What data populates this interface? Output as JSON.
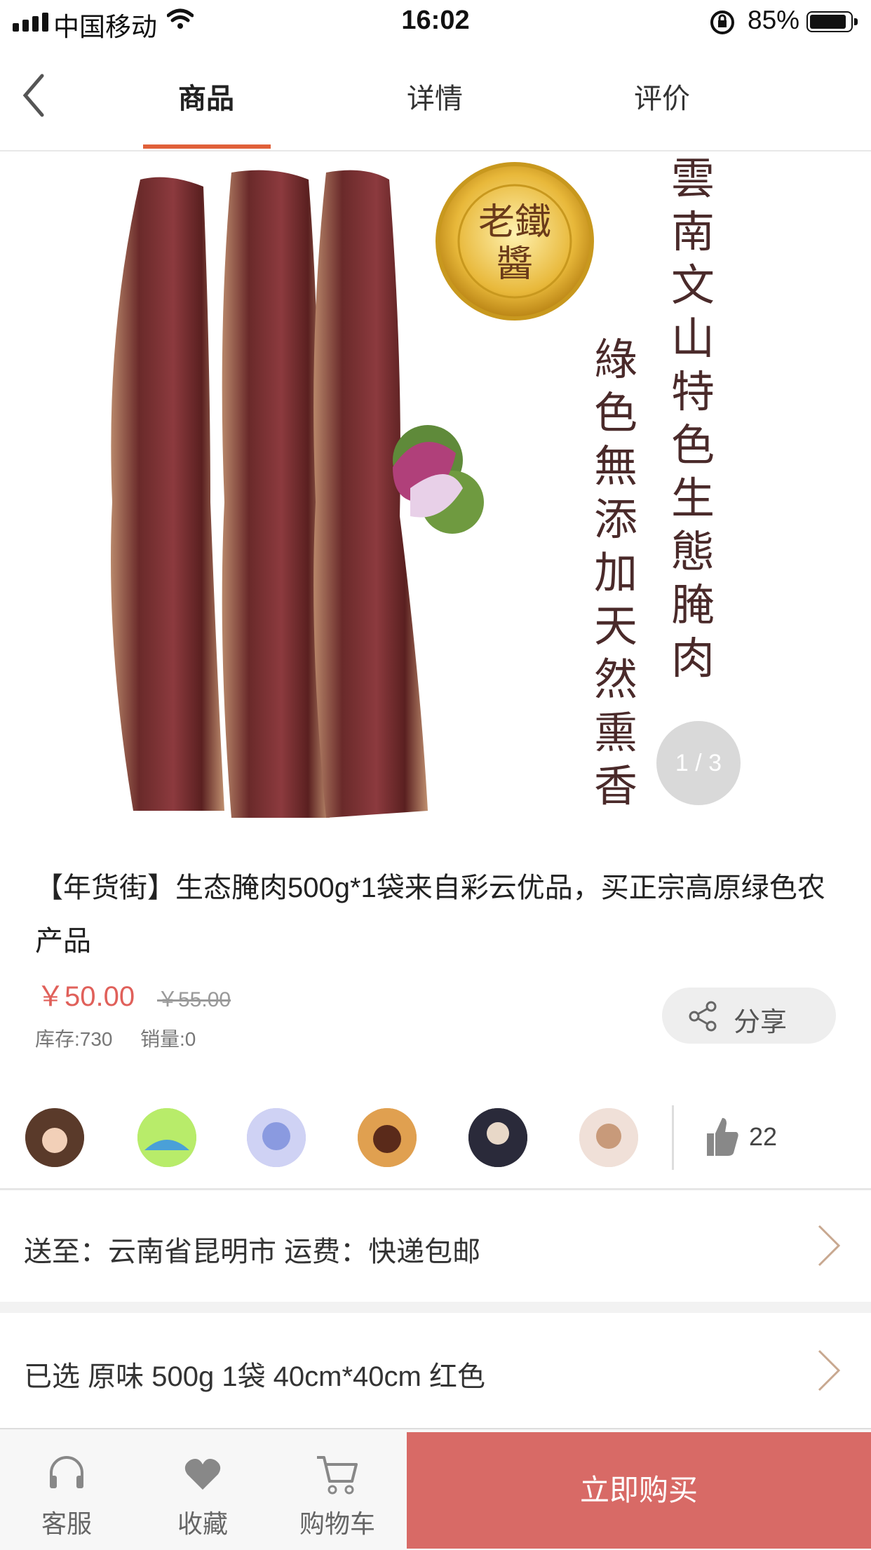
{
  "status_bar": {
    "carrier": "中国移动",
    "time": "16:02",
    "battery": "85%"
  },
  "nav": {
    "tabs": [
      {
        "label": "商品"
      },
      {
        "label": "详情"
      },
      {
        "label": "评价"
      }
    ],
    "active_tab": "商品"
  },
  "hero": {
    "brand_seal": "老鐵醬",
    "headline_vertical": "雲南文山特色生態腌肉",
    "sub_vertical": "綠色無添加天然熏香",
    "pager": "1 / 3"
  },
  "product": {
    "title": "【年货街】生态腌肉500g*1袋来自彩云优品，买正宗高原绿色农产品",
    "price": "￥50.00",
    "old_price": "￥55.00",
    "stock": "库存:730",
    "sales": "销量:0",
    "share_label": "分享"
  },
  "likes": {
    "count": "22"
  },
  "shipping": {
    "text": "送至：云南省昆明市   运费：快递包邮"
  },
  "selection": {
    "text": "已选 原味 500g 1袋 40cm*40cm 红色"
  },
  "bottom_bar": {
    "service": "客服",
    "favorite": "收藏",
    "cart": "购物车",
    "buy_now": "立即购买"
  },
  "colors": {
    "accent": "#e0603a",
    "price": "#e0605a",
    "buy_button": "#d86a66"
  }
}
